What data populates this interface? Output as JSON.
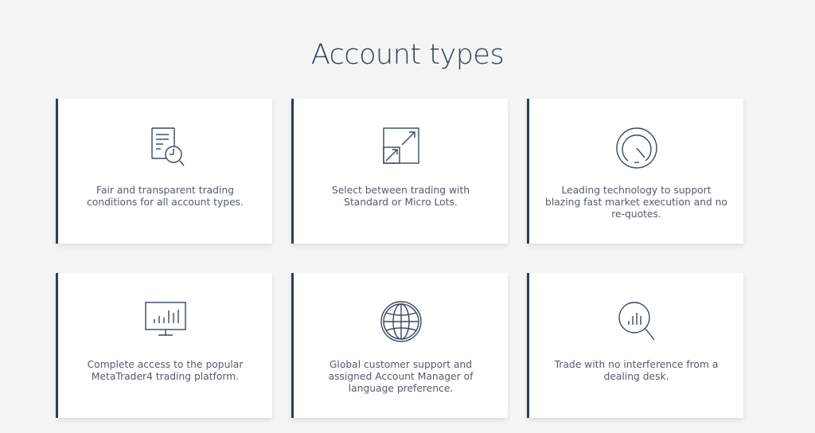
{
  "page": {
    "title": "Account types"
  },
  "features": [
    {
      "icon": "document-search-icon",
      "text": "Fair and transparent trading conditions for all account types."
    },
    {
      "icon": "resize-arrows-icon",
      "text": "Select between trading with Standard or Micro Lots."
    },
    {
      "icon": "speedometer-icon",
      "text": "Leading technology to support blazing fast market execution and no re-quotes."
    },
    {
      "icon": "monitor-chart-icon",
      "text": "Complete access to the popular MetaTrader4 trading platform."
    },
    {
      "icon": "globe-icon",
      "text": "Global customer support and assigned Account Manager of language preference."
    },
    {
      "icon": "magnifier-chart-icon",
      "text": "Trade with no interference from a dealing desk."
    }
  ],
  "colors": {
    "accent": "#2f3b56",
    "background": "#f5f5f6",
    "text": "#555b66",
    "icon_stroke": "#3a4660"
  }
}
